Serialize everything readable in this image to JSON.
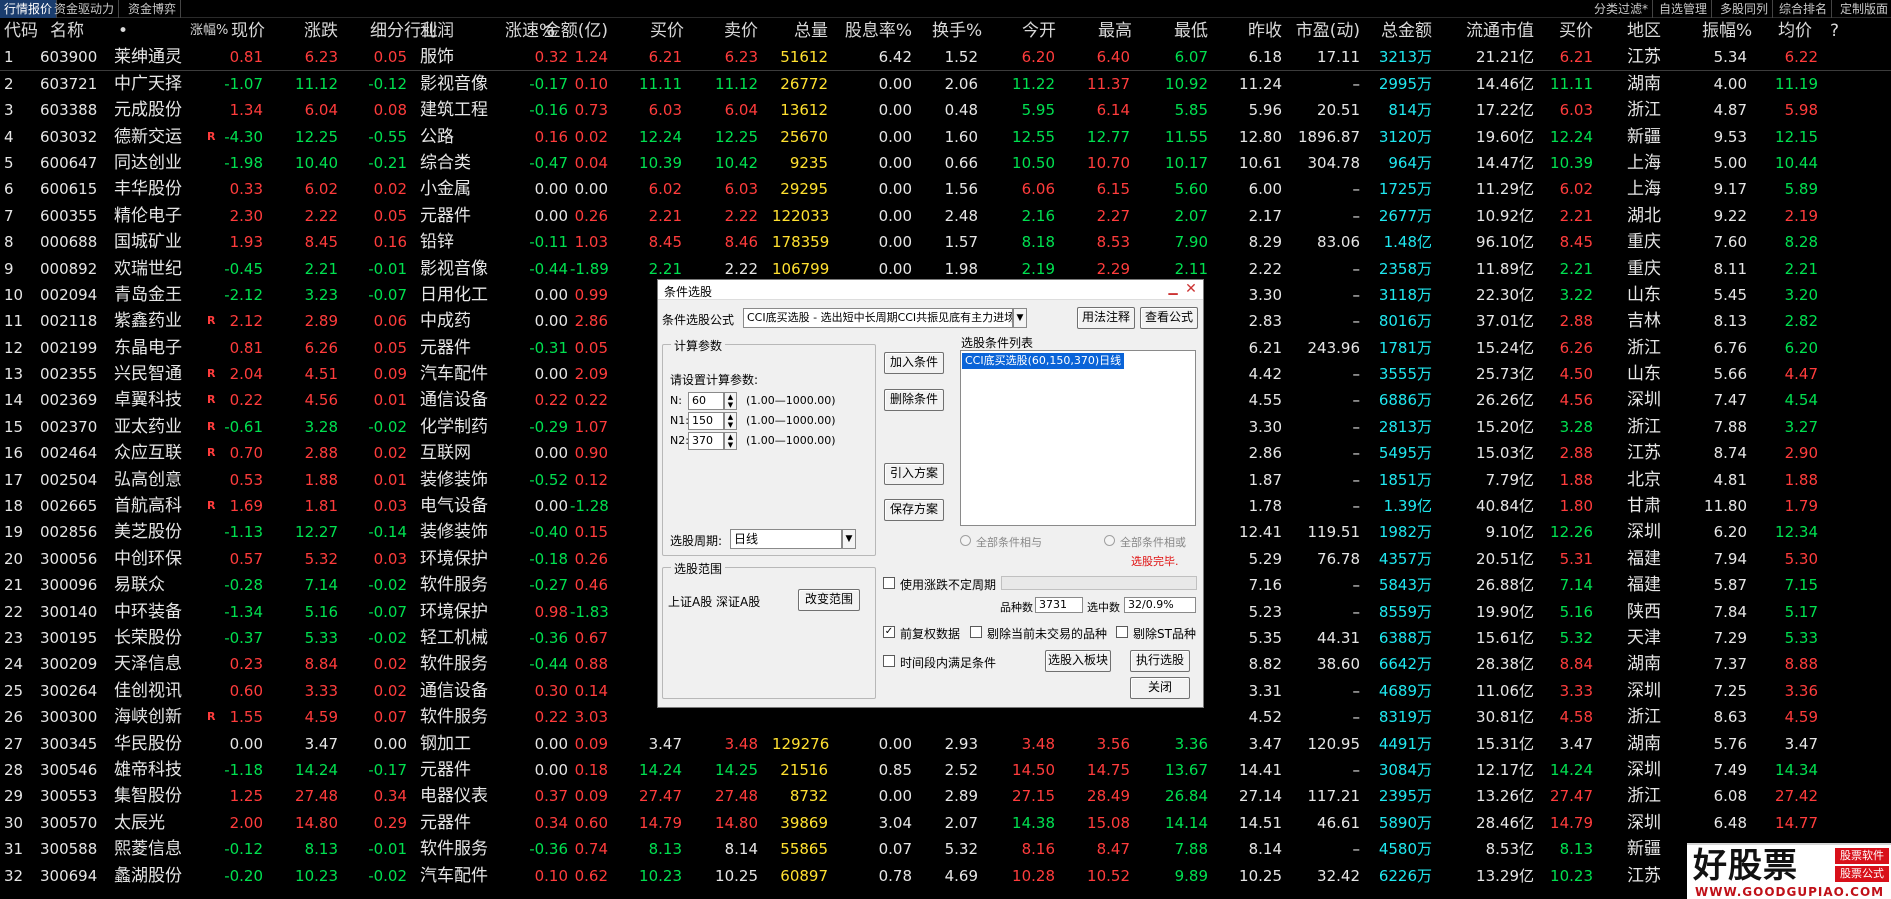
{
  "tabs_left": [
    "行情报价",
    "资金驱动力",
    "资金博弈"
  ],
  "tabs_right": [
    "分类过滤*",
    "自选管理",
    "多股同列",
    "综合排名",
    "定制版面"
  ],
  "columns": [
    "代码",
    "名称",
    "•",
    "涨幅%",
    "现价",
    "涨跌",
    "细分行业",
    "利润",
    "涨速%",
    "金额(亿)",
    "买价",
    "卖价",
    "总量",
    "股息率%",
    "换手%",
    "今开",
    "最高",
    "最低",
    "昨收",
    "市盈(动)",
    "总金额",
    "流通市值",
    "买价",
    "地区",
    "振幅%",
    "均价",
    "?"
  ],
  "rows": [
    {
      "n": "1",
      "code": "603900",
      "name": "莱绅通灵",
      "m": "",
      "chg": "0.81",
      "price": "6.23",
      "up": "0.05",
      "ind": "服饰",
      "spd": "0.32",
      "amt": "1.24",
      "bid": "6.21",
      "ask": "6.23",
      "vol": "51612",
      "div": "6.42",
      "turn": "1.52",
      "open": "6.20",
      "high": "6.40",
      "low": "6.07",
      "prev": "6.18",
      "pe": "17.11",
      "tamt": "3213万",
      "mcap": "21.21亿",
      "bid2": "6.21",
      "area": "江苏",
      "amp": "5.34",
      "avg": "6.22"
    },
    {
      "n": "2",
      "code": "603721",
      "name": "中广天择",
      "m": "",
      "chg": "-1.07",
      "price": "11.12",
      "up": "-0.12",
      "ind": "影视音像",
      "spd": "-0.17",
      "amt": "0.10",
      "bid": "11.11",
      "ask": "11.12",
      "vol": "26772",
      "div": "0.00",
      "turn": "2.06",
      "open": "11.22",
      "high": "11.37",
      "low": "10.92",
      "prev": "11.24",
      "pe": "–",
      "tamt": "2995万",
      "mcap": "14.46亿",
      "bid2": "11.11",
      "area": "湖南",
      "amp": "4.00",
      "avg": "11.19"
    },
    {
      "n": "3",
      "code": "603388",
      "name": "元成股份",
      "m": "",
      "chg": "1.34",
      "price": "6.04",
      "up": "0.08",
      "ind": "建筑工程",
      "spd": "-0.16",
      "amt": "0.73",
      "bid": "6.03",
      "ask": "6.04",
      "vol": "13612",
      "div": "0.00",
      "turn": "0.48",
      "open": "5.95",
      "high": "6.14",
      "low": "5.85",
      "prev": "5.96",
      "pe": "20.51",
      "tamt": "814万",
      "mcap": "17.22亿",
      "bid2": "6.03",
      "area": "浙江",
      "amp": "4.87",
      "avg": "5.98"
    },
    {
      "n": "4",
      "code": "603032",
      "name": "德新交运",
      "m": "R",
      "chg": "-4.30",
      "price": "12.25",
      "up": "-0.55",
      "ind": "公路",
      "spd": "0.16",
      "amt": "0.02",
      "bid": "12.24",
      "ask": "12.25",
      "vol": "25670",
      "div": "0.00",
      "turn": "1.60",
      "open": "12.55",
      "high": "12.77",
      "low": "11.55",
      "prev": "12.80",
      "pe": "1896.87",
      "tamt": "3120万",
      "mcap": "19.60亿",
      "bid2": "12.24",
      "area": "新疆",
      "amp": "9.53",
      "avg": "12.15"
    },
    {
      "n": "5",
      "code": "600647",
      "name": "同达创业",
      "m": "",
      "chg": "-1.98",
      "price": "10.40",
      "up": "-0.21",
      "ind": "综合类",
      "spd": "-0.47",
      "amt": "0.04",
      "bid": "10.39",
      "ask": "10.42",
      "vol": "9235",
      "div": "0.00",
      "turn": "0.66",
      "open": "10.50",
      "high": "10.70",
      "low": "10.17",
      "prev": "10.61",
      "pe": "304.78",
      "tamt": "964万",
      "mcap": "14.47亿",
      "bid2": "10.39",
      "area": "上海",
      "amp": "5.00",
      "avg": "10.44"
    },
    {
      "n": "6",
      "code": "600615",
      "name": "丰华股份",
      "m": "",
      "chg": "0.33",
      "price": "6.02",
      "up": "0.02",
      "ind": "小金属",
      "spd": "0.00",
      "amt": "0.00",
      "bid": "6.02",
      "ask": "6.03",
      "vol": "29295",
      "div": "0.00",
      "turn": "1.56",
      "open": "6.06",
      "high": "6.15",
      "low": "5.60",
      "prev": "6.00",
      "pe": "–",
      "tamt": "1725万",
      "mcap": "11.29亿",
      "bid2": "6.02",
      "area": "上海",
      "amp": "9.17",
      "avg": "5.89"
    },
    {
      "n": "7",
      "code": "600355",
      "name": "精伦电子",
      "m": "",
      "chg": "2.30",
      "price": "2.22",
      "up": "0.05",
      "ind": "元器件",
      "spd": "0.00",
      "amt": "0.26",
      "bid": "2.21",
      "ask": "2.22",
      "vol": "122033",
      "div": "0.00",
      "turn": "2.48",
      "open": "2.16",
      "high": "2.27",
      "low": "2.07",
      "prev": "2.17",
      "pe": "–",
      "tamt": "2677万",
      "mcap": "10.92亿",
      "bid2": "2.21",
      "area": "湖北",
      "amp": "9.22",
      "avg": "2.19"
    },
    {
      "n": "8",
      "code": "000688",
      "name": "国城矿业",
      "m": "",
      "chg": "1.93",
      "price": "8.45",
      "up": "0.16",
      "ind": "铅锌",
      "spd": "-0.11",
      "amt": "1.03",
      "bid": "8.45",
      "ask": "8.46",
      "vol": "178359",
      "div": "0.00",
      "turn": "1.57",
      "open": "8.18",
      "high": "8.53",
      "low": "7.90",
      "prev": "8.29",
      "pe": "83.06",
      "tamt": "1.48亿",
      "mcap": "96.10亿",
      "bid2": "8.45",
      "area": "重庆",
      "amp": "7.60",
      "avg": "8.28"
    },
    {
      "n": "9",
      "code": "000892",
      "name": "欢瑞世纪",
      "m": "",
      "chg": "-0.45",
      "price": "2.21",
      "up": "-0.01",
      "ind": "影视音像",
      "spd": "-0.44",
      "amt": "-1.89",
      "bid": "2.21",
      "ask": "2.22",
      "vol": "106799",
      "div": "0.00",
      "turn": "1.98",
      "open": "2.19",
      "high": "2.29",
      "low": "2.11",
      "prev": "2.22",
      "pe": "–",
      "tamt": "2358万",
      "mcap": "11.89亿",
      "bid2": "2.21",
      "area": "重庆",
      "amp": "8.11",
      "avg": "2.21"
    },
    {
      "n": "10",
      "code": "002094",
      "name": "青岛金王",
      "m": "",
      "chg": "-2.12",
      "price": "3.23",
      "up": "-0.07",
      "ind": "日用化工",
      "spd": "0.00",
      "amt": "0.99",
      "bid": "",
      "ask": "",
      "vol": "",
      "div": "",
      "turn": "",
      "open": "",
      "high": "",
      "low": "",
      "prev": "3.30",
      "pe": "–",
      "tamt": "3118万",
      "mcap": "22.30亿",
      "bid2": "3.22",
      "area": "山东",
      "amp": "5.45",
      "avg": "3.20"
    },
    {
      "n": "11",
      "code": "002118",
      "name": "紫鑫药业",
      "m": "R",
      "chg": "2.12",
      "price": "2.89",
      "up": "0.06",
      "ind": "中成药",
      "spd": "0.00",
      "amt": "2.86",
      "bid": "",
      "ask": "",
      "vol": "",
      "div": "",
      "turn": "",
      "open": "",
      "high": "",
      "low": "",
      "prev": "2.83",
      "pe": "–",
      "tamt": "8016万",
      "mcap": "37.01亿",
      "bid2": "2.88",
      "area": "吉林",
      "amp": "8.13",
      "avg": "2.82"
    },
    {
      "n": "12",
      "code": "002199",
      "name": "东晶电子",
      "m": "",
      "chg": "0.81",
      "price": "6.26",
      "up": "0.05",
      "ind": "元器件",
      "spd": "-0.31",
      "amt": "0.05",
      "bid": "",
      "ask": "",
      "vol": "",
      "div": "",
      "turn": "",
      "open": "",
      "high": "",
      "low": "",
      "prev": "6.21",
      "pe": "243.96",
      "tamt": "1781万",
      "mcap": "15.24亿",
      "bid2": "6.26",
      "area": "浙江",
      "amp": "6.76",
      "avg": "6.20"
    },
    {
      "n": "13",
      "code": "002355",
      "name": "兴民智通",
      "m": "R",
      "chg": "2.04",
      "price": "4.51",
      "up": "0.09",
      "ind": "汽车配件",
      "spd": "0.00",
      "amt": "2.09",
      "bid": "",
      "ask": "",
      "vol": "",
      "div": "",
      "turn": "",
      "open": "",
      "high": "",
      "low": "",
      "prev": "4.42",
      "pe": "–",
      "tamt": "3555万",
      "mcap": "25.73亿",
      "bid2": "4.50",
      "area": "山东",
      "amp": "5.66",
      "avg": "4.47"
    },
    {
      "n": "14",
      "code": "002369",
      "name": "卓翼科技",
      "m": "R",
      "chg": "0.22",
      "price": "4.56",
      "up": "0.01",
      "ind": "通信设备",
      "spd": "0.22",
      "amt": "0.22",
      "bid": "",
      "ask": "",
      "vol": "",
      "div": "",
      "turn": "",
      "open": "",
      "high": "",
      "low": "",
      "prev": "4.55",
      "pe": "–",
      "tamt": "6886万",
      "mcap": "26.26亿",
      "bid2": "4.56",
      "area": "深圳",
      "amp": "7.47",
      "avg": "4.54"
    },
    {
      "n": "15",
      "code": "002370",
      "name": "亚太药业",
      "m": "R",
      "chg": "-0.61",
      "price": "3.28",
      "up": "-0.02",
      "ind": "化学制药",
      "spd": "-0.29",
      "amt": "1.07",
      "bid": "",
      "ask": "",
      "vol": "",
      "div": "",
      "turn": "",
      "open": "",
      "high": "",
      "low": "",
      "prev": "3.30",
      "pe": "–",
      "tamt": "2813万",
      "mcap": "15.20亿",
      "bid2": "3.28",
      "area": "浙江",
      "amp": "7.88",
      "avg": "3.27"
    },
    {
      "n": "16",
      "code": "002464",
      "name": "众应互联",
      "m": "R",
      "chg": "0.70",
      "price": "2.88",
      "up": "0.02",
      "ind": "互联网",
      "spd": "0.00",
      "amt": "0.90",
      "bid": "",
      "ask": "",
      "vol": "",
      "div": "",
      "turn": "",
      "open": "",
      "high": "",
      "low": "",
      "prev": "2.86",
      "pe": "–",
      "tamt": "5495万",
      "mcap": "15.03亿",
      "bid2": "2.88",
      "area": "江苏",
      "amp": "8.74",
      "avg": "2.90"
    },
    {
      "n": "17",
      "code": "002504",
      "name": "弘高创意",
      "m": "",
      "chg": "0.53",
      "price": "1.88",
      "up": "0.01",
      "ind": "装修装饰",
      "spd": "-0.52",
      "amt": "0.12",
      "bid": "",
      "ask": "",
      "vol": "",
      "div": "",
      "turn": "",
      "open": "",
      "high": "",
      "low": "",
      "prev": "1.87",
      "pe": "–",
      "tamt": "1851万",
      "mcap": "7.79亿",
      "bid2": "1.88",
      "area": "北京",
      "amp": "4.81",
      "avg": "1.88"
    },
    {
      "n": "18",
      "code": "002665",
      "name": "首航高科",
      "m": "R",
      "chg": "1.69",
      "price": "1.81",
      "up": "0.03",
      "ind": "电气设备",
      "spd": "0.00",
      "amt": "-1.28",
      "bid": "",
      "ask": "",
      "vol": "",
      "div": "",
      "turn": "",
      "open": "",
      "high": "",
      "low": "",
      "prev": "1.78",
      "pe": "–",
      "tamt": "1.39亿",
      "mcap": "40.84亿",
      "bid2": "1.80",
      "area": "甘肃",
      "amp": "11.80",
      "avg": "1.79"
    },
    {
      "n": "19",
      "code": "002856",
      "name": "美芝股份",
      "m": "",
      "chg": "-1.13",
      "price": "12.27",
      "up": "-0.14",
      "ind": "装修装饰",
      "spd": "-0.40",
      "amt": "0.15",
      "bid": "12",
      "ask": "",
      "vol": "",
      "div": "",
      "turn": "",
      "open": "",
      "high": "",
      "low": "",
      "prev": "12.41",
      "pe": "119.51",
      "tamt": "1982万",
      "mcap": "9.10亿",
      "bid2": "12.26",
      "area": "深圳",
      "amp": "6.20",
      "avg": "12.34"
    },
    {
      "n": "20",
      "code": "300056",
      "name": "中创环保",
      "m": "",
      "chg": "0.57",
      "price": "5.32",
      "up": "0.03",
      "ind": "环境保护",
      "spd": "-0.18",
      "amt": "0.26",
      "bid": "",
      "ask": "",
      "vol": "",
      "div": "",
      "turn": "",
      "open": "",
      "high": "",
      "low": "",
      "prev": "5.29",
      "pe": "76.78",
      "tamt": "4357万",
      "mcap": "20.51亿",
      "bid2": "5.31",
      "area": "福建",
      "amp": "7.94",
      "avg": "5.30"
    },
    {
      "n": "21",
      "code": "300096",
      "name": "易联众",
      "m": "",
      "chg": "-0.28",
      "price": "7.14",
      "up": "-0.02",
      "ind": "软件服务",
      "spd": "-0.27",
      "amt": "0.46",
      "bid": "",
      "ask": "",
      "vol": "",
      "div": "",
      "turn": "",
      "open": "",
      "high": "",
      "low": "",
      "prev": "7.16",
      "pe": "–",
      "tamt": "5843万",
      "mcap": "26.88亿",
      "bid2": "7.14",
      "area": "福建",
      "amp": "5.87",
      "avg": "7.15"
    },
    {
      "n": "22",
      "code": "300140",
      "name": "中环装备",
      "m": "",
      "chg": "-1.34",
      "price": "5.16",
      "up": "-0.07",
      "ind": "环境保护",
      "spd": "0.98",
      "amt": "-1.83",
      "bid": "",
      "ask": "",
      "vol": "",
      "div": "",
      "turn": "",
      "open": "",
      "high": "",
      "low": "",
      "prev": "5.23",
      "pe": "–",
      "tamt": "8559万",
      "mcap": "19.90亿",
      "bid2": "5.16",
      "area": "陕西",
      "amp": "7.84",
      "avg": "5.17"
    },
    {
      "n": "23",
      "code": "300195",
      "name": "长荣股份",
      "m": "",
      "chg": "-0.37",
      "price": "5.33",
      "up": "-0.02",
      "ind": "轻工机械",
      "spd": "-0.36",
      "amt": "0.67",
      "bid": "",
      "ask": "",
      "vol": "",
      "div": "",
      "turn": "",
      "open": "",
      "high": "",
      "low": "",
      "prev": "5.35",
      "pe": "44.31",
      "tamt": "6388万",
      "mcap": "15.61亿",
      "bid2": "5.32",
      "area": "天津",
      "amp": "7.29",
      "avg": "5.33"
    },
    {
      "n": "24",
      "code": "300209",
      "name": "天泽信息",
      "m": "",
      "chg": "0.23",
      "price": "8.84",
      "up": "0.02",
      "ind": "软件服务",
      "spd": "-0.44",
      "amt": "0.88",
      "bid": "",
      "ask": "",
      "vol": "",
      "div": "",
      "turn": "",
      "open": "",
      "high": "",
      "low": "",
      "prev": "8.82",
      "pe": "38.60",
      "tamt": "6642万",
      "mcap": "28.38亿",
      "bid2": "8.84",
      "area": "湖南",
      "amp": "7.37",
      "avg": "8.88"
    },
    {
      "n": "25",
      "code": "300264",
      "name": "佳创视讯",
      "m": "",
      "chg": "0.60",
      "price": "3.33",
      "up": "0.02",
      "ind": "通信设备",
      "spd": "0.30",
      "amt": "0.14",
      "bid": "",
      "ask": "",
      "vol": "",
      "div": "",
      "turn": "",
      "open": "",
      "high": "",
      "low": "",
      "prev": "3.31",
      "pe": "–",
      "tamt": "4689万",
      "mcap": "11.06亿",
      "bid2": "3.33",
      "area": "深圳",
      "amp": "7.25",
      "avg": "3.36"
    },
    {
      "n": "26",
      "code": "300300",
      "name": "海峡创新",
      "m": "R",
      "chg": "1.55",
      "price": "4.59",
      "up": "0.07",
      "ind": "软件服务",
      "spd": "0.22",
      "amt": "3.03",
      "bid": "",
      "ask": "",
      "vol": "",
      "div": "",
      "turn": "",
      "open": "",
      "high": "",
      "low": "",
      "prev": "4.52",
      "pe": "–",
      "tamt": "8319万",
      "mcap": "30.81亿",
      "bid2": "4.58",
      "area": "浙江",
      "amp": "8.63",
      "avg": "4.59"
    },
    {
      "n": "27",
      "code": "300345",
      "name": "华民股份",
      "m": "",
      "chg": "0.00",
      "price": "3.47",
      "up": "0.00",
      "ind": "钢加工",
      "spd": "0.00",
      "amt": "0.09",
      "bid": "3.47",
      "ask": "3.48",
      "vol": "129276",
      "div": "0.00",
      "turn": "2.93",
      "open": "3.48",
      "high": "3.56",
      "low": "3.36",
      "prev": "3.47",
      "pe": "120.95",
      "tamt": "4491万",
      "mcap": "15.31亿",
      "bid2": "3.47",
      "area": "湖南",
      "amp": "5.76",
      "avg": "3.47"
    },
    {
      "n": "28",
      "code": "300546",
      "name": "雄帝科技",
      "m": "",
      "chg": "-1.18",
      "price": "14.24",
      "up": "-0.17",
      "ind": "元器件",
      "spd": "0.00",
      "amt": "0.18",
      "bid": "14.24",
      "ask": "14.25",
      "vol": "21516",
      "div": "0.85",
      "turn": "2.52",
      "open": "14.50",
      "high": "14.75",
      "low": "13.67",
      "prev": "14.41",
      "pe": "–",
      "tamt": "3084万",
      "mcap": "12.17亿",
      "bid2": "14.24",
      "area": "深圳",
      "amp": "7.49",
      "avg": "14.34"
    },
    {
      "n": "29",
      "code": "300553",
      "name": "集智股份",
      "m": "",
      "chg": "1.25",
      "price": "27.48",
      "up": "0.34",
      "ind": "电器仪表",
      "spd": "0.37",
      "amt": "0.09",
      "bid": "27.47",
      "ask": "27.48",
      "vol": "8732",
      "div": "0.00",
      "turn": "2.89",
      "open": "27.15",
      "high": "28.49",
      "low": "26.84",
      "prev": "27.14",
      "pe": "117.21",
      "tamt": "2395万",
      "mcap": "13.26亿",
      "bid2": "27.47",
      "area": "浙江",
      "amp": "6.08",
      "avg": "27.42"
    },
    {
      "n": "30",
      "code": "300570",
      "name": "太辰光",
      "m": "",
      "chg": "2.00",
      "price": "14.80",
      "up": "0.29",
      "ind": "元器件",
      "spd": "0.34",
      "amt": "0.60",
      "bid": "14.79",
      "ask": "14.80",
      "vol": "39869",
      "div": "3.04",
      "turn": "2.07",
      "open": "14.38",
      "high": "15.08",
      "low": "14.14",
      "prev": "14.51",
      "pe": "46.61",
      "tamt": "5890万",
      "mcap": "28.46亿",
      "bid2": "14.79",
      "area": "深圳",
      "amp": "6.48",
      "avg": "14.77"
    },
    {
      "n": "31",
      "code": "300588",
      "name": "熙菱信息",
      "m": "",
      "chg": "-0.12",
      "price": "8.13",
      "up": "-0.01",
      "ind": "软件服务",
      "spd": "-0.36",
      "amt": "0.74",
      "bid": "8.13",
      "ask": "8.14",
      "vol": "55865",
      "div": "0.07",
      "turn": "5.32",
      "open": "8.16",
      "high": "8.47",
      "low": "7.88",
      "prev": "8.14",
      "pe": "–",
      "tamt": "4580万",
      "mcap": "8.53亿",
      "bid2": "8.13",
      "area": "新疆",
      "amp": "7.25",
      "avg": "8.20"
    },
    {
      "n": "32",
      "code": "300694",
      "name": "蠡湖股份",
      "m": "",
      "chg": "-0.20",
      "price": "10.23",
      "up": "-0.02",
      "ind": "汽车配件",
      "spd": "0.10",
      "amt": "0.62",
      "bid": "10.23",
      "ask": "10.25",
      "vol": "60897",
      "div": "0.78",
      "turn": "4.69",
      "open": "10.28",
      "high": "10.52",
      "low": "9.89",
      "prev": "10.25",
      "pe": "32.42",
      "tamt": "6226万",
      "mcap": "13.29亿",
      "bid2": "10.23",
      "area": "江苏",
      "amp": "",
      "avg": ""
    }
  ],
  "dialog": {
    "title": "条件选股",
    "formula_label": "条件选股公式",
    "formula_value": "CCI底买选股 - 选出短中长周期CCI共振见底有主力进场",
    "btn_usage": "用法注释",
    "btn_view": "查看公式",
    "params_group": "计算参数",
    "params_prompt": "请设置计算参数:",
    "params": [
      {
        "label": "N:",
        "value": "60",
        "range": "(1.00—1000.00)"
      },
      {
        "label": "N1:",
        "value": "150",
        "range": "(1.00—1000.00)"
      },
      {
        "label": "N2:",
        "value": "370",
        "range": "(1.00—1000.00)"
      }
    ],
    "period_label": "选股周期:",
    "period_value": "日线",
    "btn_add": "加入条件",
    "btn_delete": "删除条件",
    "btn_import": "引入方案",
    "btn_save": "保存方案",
    "list_label": "选股条件列表",
    "list_item": "CCI底买选股(60,150,370)日线",
    "radio_and": "全部条件相与",
    "radio_or": "全部条件相或",
    "status": "选股完毕.",
    "range_group": "选股范围",
    "range_value": "上证A股 深证A股",
    "btn_range": "改变范围",
    "chk_uncertain": "使用涨跌不定周期",
    "count_label": "品种数",
    "count_value": "3731",
    "hit_label": "选中数",
    "hit_value": "32/0.9%",
    "chk_rights": "前复权数据",
    "chk_rights_checked": "✓",
    "chk_exclude_untraded": "剔除当前未交易的品种",
    "chk_exclude_st": "剔除ST品种",
    "chk_period": "时间段内满足条件",
    "btn_to_block": "选股入板块",
    "btn_run": "执行选股",
    "btn_close": "关闭"
  },
  "watermark": {
    "logo": "好股票",
    "badge1": "股票软件",
    "badge2": "股票公式",
    "url": "WWW.GOODGUPIAO.COM"
  },
  "colors": {
    "up": "#ff3c3c",
    "down": "#00e050",
    "volume": "#ffe030",
    "amount": "#20e8f0",
    "neutral": "#e6e6e6"
  }
}
